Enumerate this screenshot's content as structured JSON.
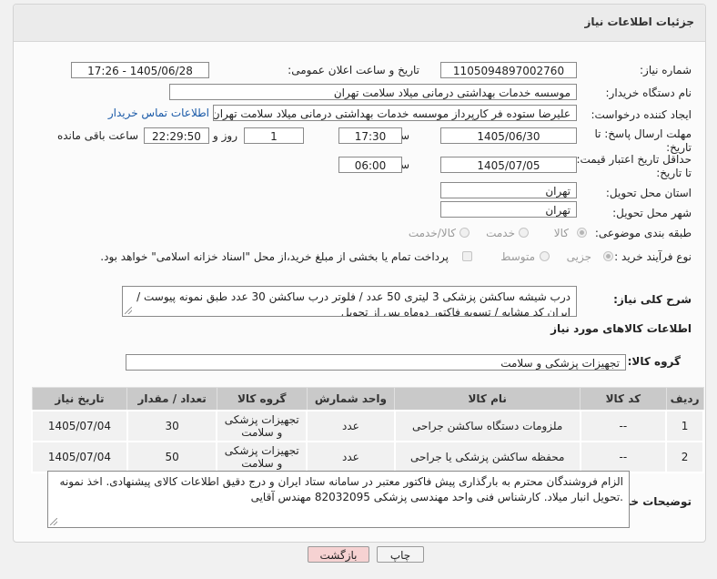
{
  "panel": {
    "title": "جزئیات اطلاعات نیاز"
  },
  "need_number": {
    "label": "شماره نیاز:",
    "value": "1105094897002760"
  },
  "announce": {
    "label": "تاریخ و ساعت اعلان عمومی:",
    "value": "1405/06/28 - 17:26"
  },
  "buyer_org": {
    "label": "نام دستگاه خریدار:",
    "value": "موسسه خدمات بهداشتی درمانی میلاد سلامت تهران"
  },
  "creator": {
    "label": "ایجاد کننده درخواست:",
    "value": "علیرضا ستوده فر کارپرداز موسسه خدمات بهداشتی درمانی میلاد سلامت تهران",
    "contact_link": "اطلاعات تماس خریدار"
  },
  "deadline": {
    "label_line1": "مهلت ارسال پاسخ: تا",
    "label_line2": "تاریخ:",
    "date": "1405/06/30",
    "time_label": "ساعت",
    "time": "17:30",
    "days": "1",
    "days_label": "روز و",
    "remaining": "22:29:50",
    "remaining_label": "ساعت باقی مانده"
  },
  "validity": {
    "label_line1": "حداقل تاریخ اعتبار قیمت:",
    "label_line2": "تا تاریخ:",
    "date": "1405/07/05",
    "time_label": "ساعت",
    "time": "06:00"
  },
  "province": {
    "label": "استان محل تحویل:",
    "value": "تهران"
  },
  "city": {
    "label": "شهر محل تحویل:",
    "value": "تهران"
  },
  "category": {
    "label": "طبقه بندی موضوعی:",
    "options": [
      "کالا",
      "خدمت",
      "کالا/خدمت"
    ]
  },
  "purchase_type": {
    "label": "نوع فرآیند خرید :",
    "options": [
      "جزیی",
      "متوسط"
    ],
    "note": "پرداخت تمام یا بخشی از مبلغ خرید،از محل \"اسناد خزانه اسلامی\" خواهد بود."
  },
  "description": {
    "label": "شرح کلی نیاز:",
    "text": "درب شیشه ساکشن پزشکی 3 لیتری 50 عدد / فلوتر درب ساکشن 30 عدد طبق نمونه پیوست / ایران کد مشابه / تسویه فاکتور دوماه پس از تحویل"
  },
  "goods_info": {
    "label": "اطلاعات کالاهای مورد نیاز"
  },
  "goods_group": {
    "label": "گروه کالا:",
    "value": "تجهیزات پزشکی و سلامت"
  },
  "table": {
    "headers": [
      "ردیف",
      "کد کالا",
      "نام کالا",
      "واحد شمارش",
      "گروه کالا",
      "تعداد / مقدار",
      "تاریخ نیاز"
    ],
    "rows": [
      {
        "row": "1",
        "code": "--",
        "name": "ملزومات دستگاه ساکشن جراحی",
        "unit": "عدد",
        "group": "تجهیزات پزشکی و سلامت",
        "qty": "30",
        "date": "1405/07/04"
      },
      {
        "row": "2",
        "code": "--",
        "name": "محفظه ساکشن پزشکی یا جراحی",
        "unit": "عدد",
        "group": "تجهیزات پزشکی و سلامت",
        "qty": "50",
        "date": "1405/07/04"
      }
    ]
  },
  "buyer_notes": {
    "label": "توضیحات خریدار:",
    "text": "الزام فروشندگان محترم به بارگذاری پیش فاکتور معتبر در سامانه ستاد ایران و درج دقیق اطلاعات کالای پیشنهادی. اخذ نمونه .تحویل انبار میلاد. کارشناس فنی واحد مهندسی پزشکی 82032095 مهندس آقایی"
  },
  "buttons": {
    "print": "چاپ",
    "back": "بازگشت"
  },
  "watermark": {
    "text": "AriaTender.net"
  },
  "colors": {
    "header_bg": "#ebebeb",
    "table_header": "#c9c9c9",
    "back_button": "#f6d2d2",
    "link": "#1a5aa8"
  }
}
